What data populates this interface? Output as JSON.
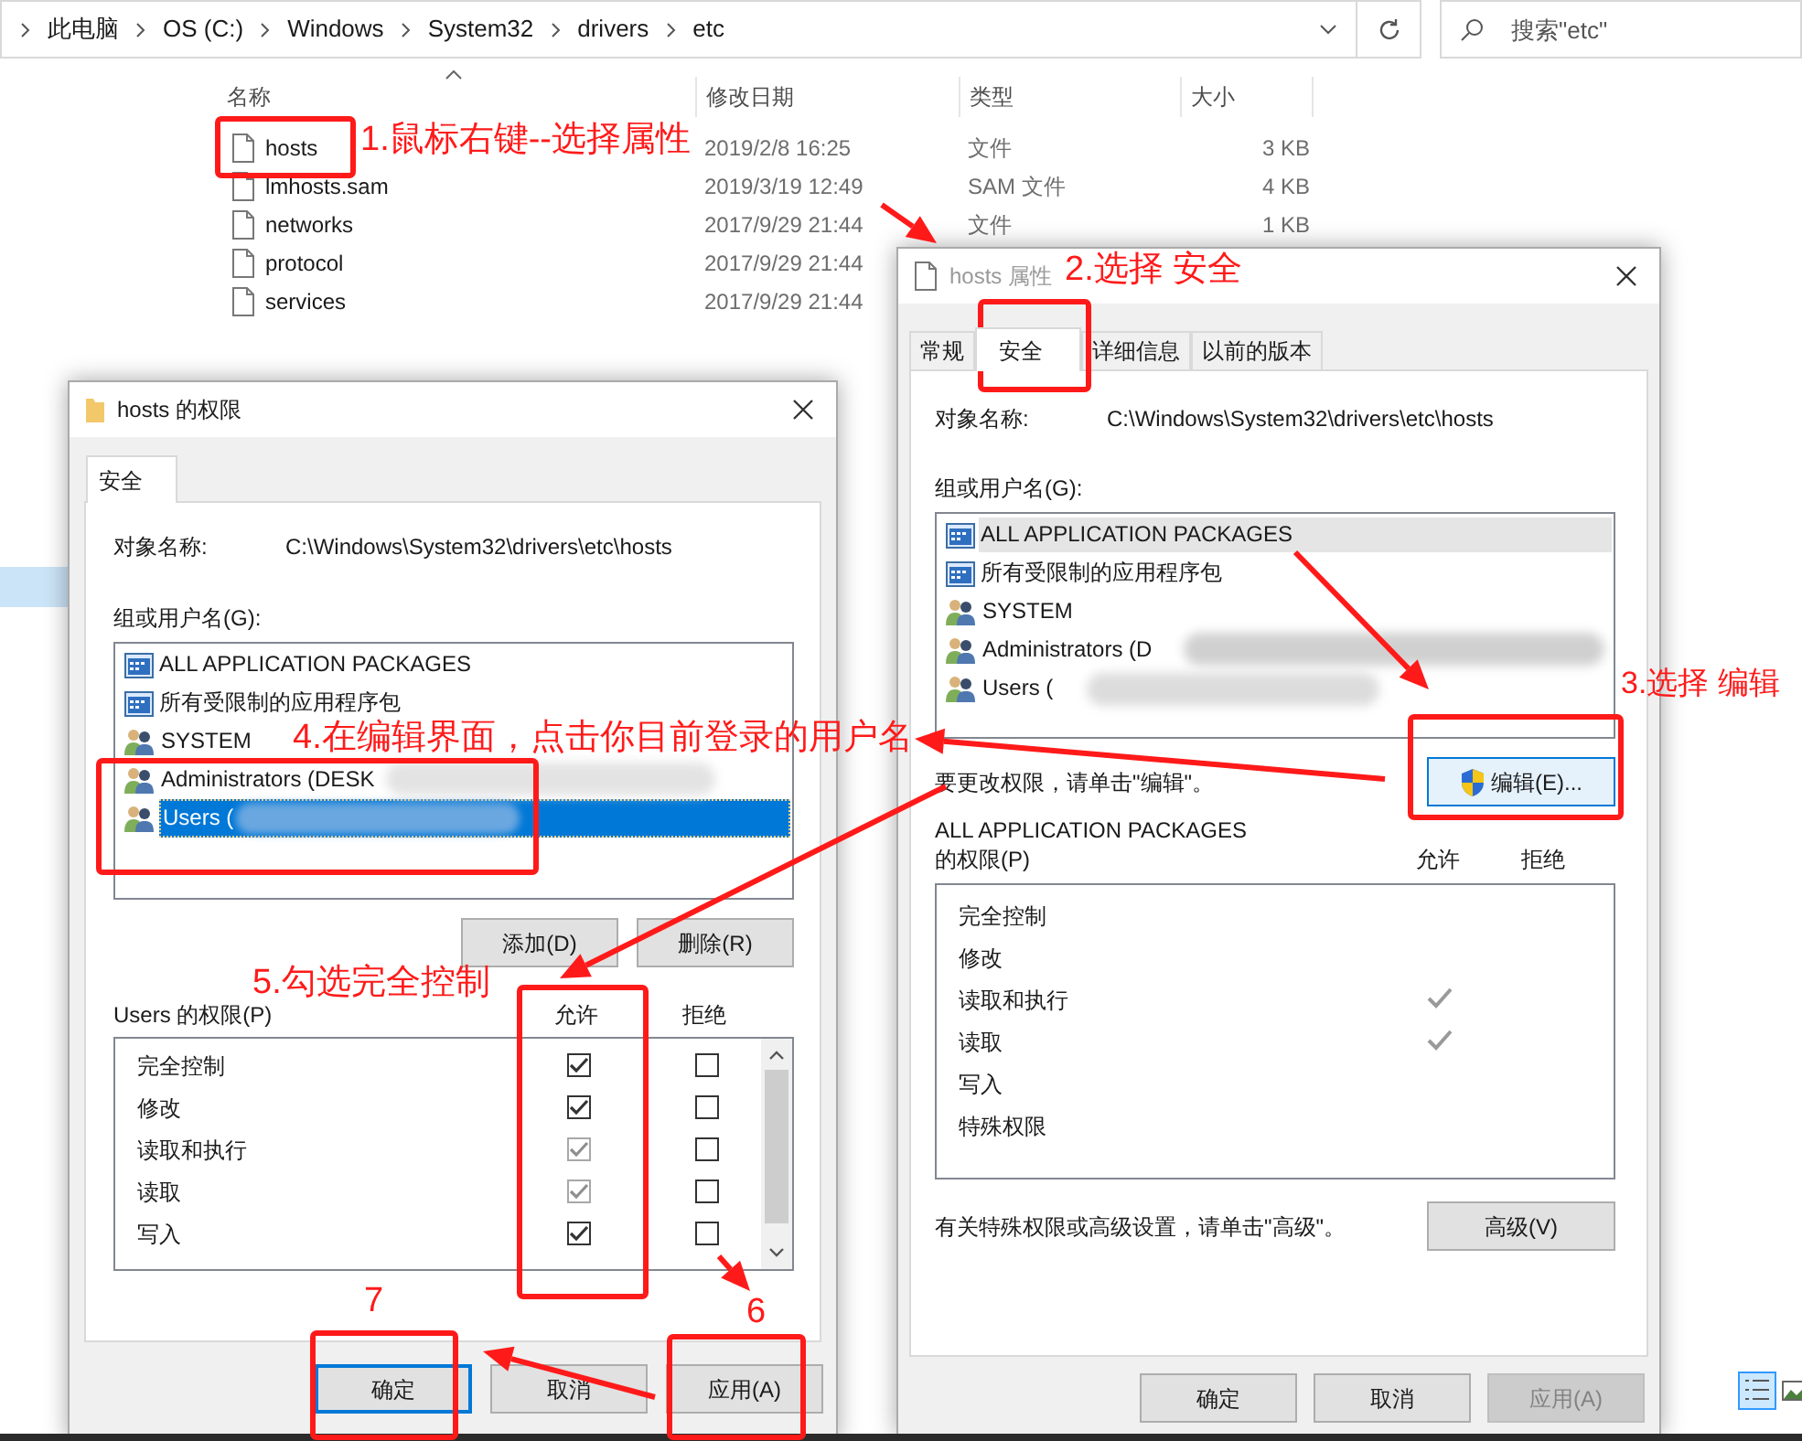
{
  "explorer": {
    "breadcrumb": [
      "此电脑",
      "OS (C:)",
      "Windows",
      "System32",
      "drivers",
      "etc"
    ],
    "search": {
      "placeholder": "搜索\"etc\""
    },
    "columns": [
      "名称",
      "修改日期",
      "类型",
      "大小"
    ],
    "files": [
      {
        "name": "hosts",
        "modified": "2019/2/8 16:25",
        "type": "文件",
        "size": "3 KB"
      },
      {
        "name": "lmhosts.sam",
        "modified": "2019/3/19 12:49",
        "type": "SAM 文件",
        "size": "4 KB"
      },
      {
        "name": "networks",
        "modified": "2017/9/29 21:44",
        "type": "文件",
        "size": "1 KB"
      },
      {
        "name": "protocol",
        "modified": "2017/9/29 21:44"
      },
      {
        "name": "services",
        "modified": "2017/9/29 21:44"
      }
    ]
  },
  "properties_dialog": {
    "title": "hosts 属性",
    "tabs": [
      {
        "label": "常规",
        "selected": false
      },
      {
        "label": "安全",
        "selected": true
      },
      {
        "label": "详细信息",
        "selected": false
      },
      {
        "label": "以前的版本",
        "selected": false
      }
    ],
    "object_label": "对象名称:",
    "object_value": "C:\\Windows\\System32\\drivers\\etc\\hosts",
    "users_label": "组或用户名(G):",
    "users": [
      {
        "name": "ALL APPLICATION PACKAGES",
        "kind": "app",
        "selected": true
      },
      {
        "name": "所有受限制的应用程序包",
        "kind": "app",
        "selected": false
      },
      {
        "name": "SYSTEM",
        "kind": "group",
        "selected": false
      },
      {
        "name": "Administrators (D",
        "kind": "group",
        "selected": false
      },
      {
        "name": "Users (",
        "kind": "group",
        "selected": false
      }
    ],
    "edit_hint": "要更改权限，请单击\"编辑\"。",
    "edit_button": "编辑(E)...",
    "perm_label_1": "ALL APPLICATION PACKAGES",
    "perm_label_2": "的权限(P)",
    "allow_header": "允许",
    "deny_header": "拒绝",
    "permissions": [
      {
        "label": "完全控制",
        "allowed": false,
        "denied": false
      },
      {
        "label": "修改",
        "allowed": false,
        "denied": false
      },
      {
        "label": "读取和执行",
        "allowed": true,
        "denied": false
      },
      {
        "label": "读取",
        "allowed": true,
        "denied": false
      },
      {
        "label": "写入",
        "allowed": false,
        "denied": false
      },
      {
        "label": "特殊权限",
        "allowed": false,
        "denied": false
      }
    ],
    "advanced_note": "有关特殊权限或高级设置，请单击\"高级\"。",
    "advanced_button": "高级(V)",
    "buttons": [
      {
        "label": "确定",
        "disabled": false
      },
      {
        "label": "取消",
        "disabled": false
      },
      {
        "label": "应用(A)",
        "disabled": true
      }
    ]
  },
  "permissions_dialog": {
    "title": "hosts 的权限",
    "tabs": [
      {
        "label": "安全",
        "selected": true
      }
    ],
    "object_label": "对象名称:",
    "object_value": "C:\\Windows\\System32\\drivers\\etc\\hosts",
    "users_label": "组或用户名(G):",
    "users": [
      {
        "name": "ALL APPLICATION PACKAGES",
        "kind": "app",
        "selected": false
      },
      {
        "name": "所有受限制的应用程序包",
        "kind": "app",
        "selected": false
      },
      {
        "name": "SYSTEM",
        "kind": "group",
        "selected": false
      },
      {
        "name": "Administrators (DESK",
        "kind": "group",
        "selected": false
      },
      {
        "name": "Users (",
        "kind": "group",
        "selected": true
      }
    ],
    "add_button": "添加(D)",
    "remove_button": "删除(R)",
    "perm_label": "Users 的权限(P)",
    "allow_header": "允许",
    "deny_header": "拒绝",
    "permissions": [
      {
        "label": "完全控制",
        "allow_checked": true,
        "allow_disabled": false,
        "deny_checked": false
      },
      {
        "label": "修改",
        "allow_checked": true,
        "allow_disabled": false,
        "deny_checked": false
      },
      {
        "label": "读取和执行",
        "allow_checked": true,
        "allow_disabled": true,
        "deny_checked": false
      },
      {
        "label": "读取",
        "allow_checked": true,
        "allow_disabled": true,
        "deny_checked": false
      },
      {
        "label": "写入",
        "allow_checked": true,
        "allow_disabled": false,
        "deny_checked": false
      }
    ],
    "buttons": [
      {
        "label": "确定",
        "focused": true
      },
      {
        "label": "取消",
        "focused": false
      },
      {
        "label": "应用(A)",
        "focused": false
      }
    ]
  },
  "annotations": [
    "1.鼠标右键--选择属性",
    "2.选择 安全",
    "3.选择 编辑",
    "4.在编辑界面，点击你目前登录的用户名",
    "5.勾选完全控制",
    "7",
    "6"
  ]
}
